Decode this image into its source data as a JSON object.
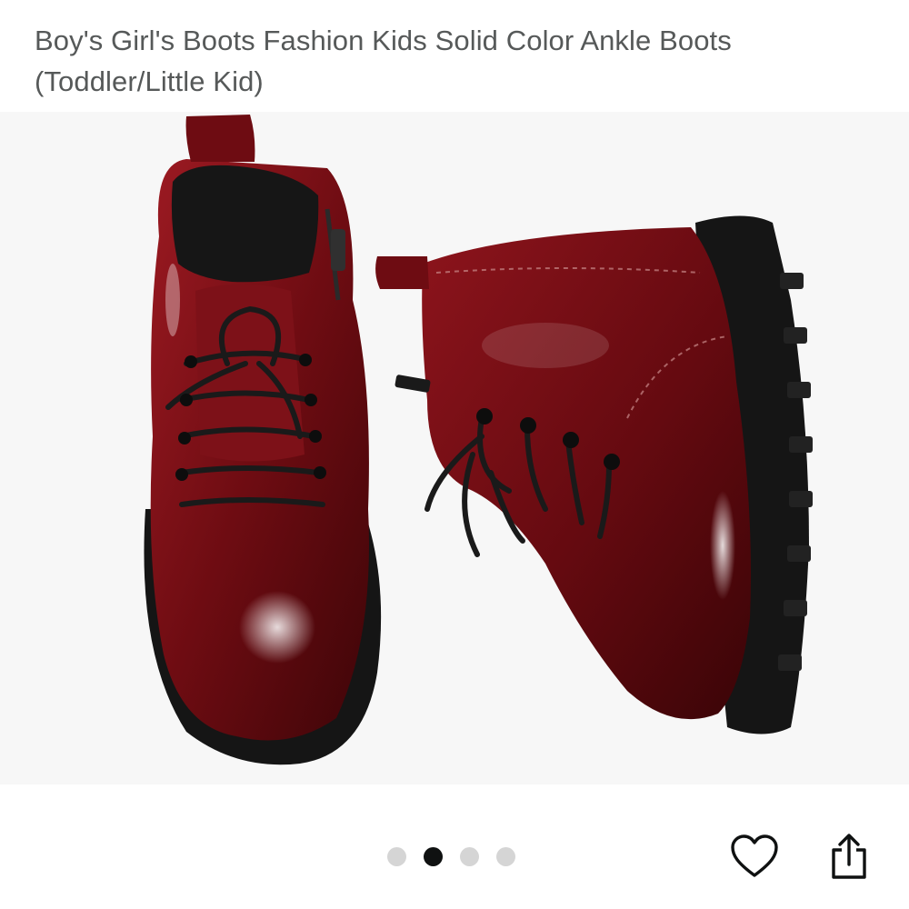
{
  "product": {
    "title": "Boy's Girl's Boots Fashion Kids Solid Color Ankle Boots (Toddler/Little Kid)",
    "image_alt": "Burgundy patent leather ankle boots with black laces and side zipper"
  },
  "carousel": {
    "total_images": 4,
    "active_index": 1
  },
  "actions": {
    "wishlist_icon": "heart-icon",
    "share_icon": "share-icon"
  },
  "colors": {
    "boot": "#7a0f14",
    "sole": "#151515",
    "dot_active": "#0f1111",
    "dot_inactive": "#d5d5d5"
  }
}
